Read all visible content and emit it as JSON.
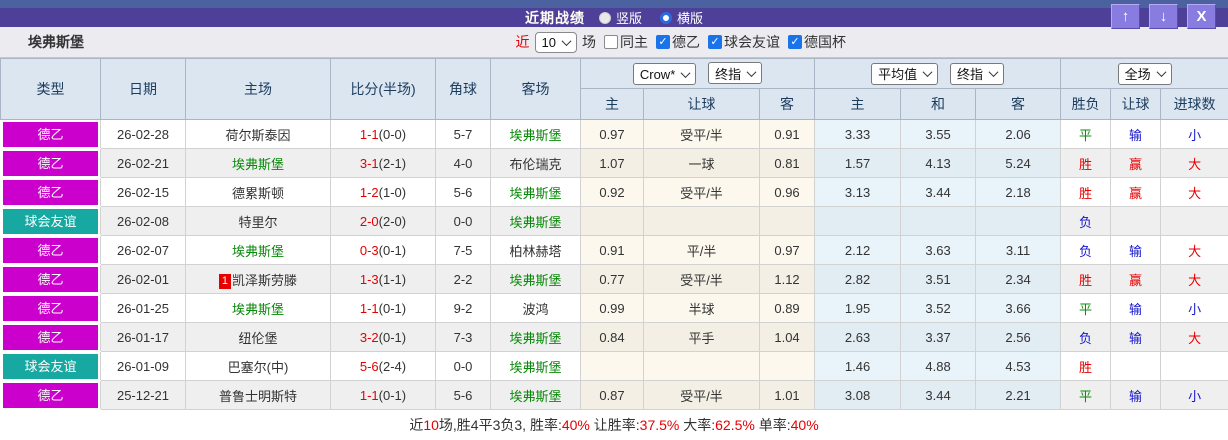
{
  "titlebar": {
    "title": "近期战绩",
    "radios": {
      "vertical": {
        "label": "竖版",
        "checked": false
      },
      "horizontal": {
        "label": "横版",
        "checked": true
      }
    }
  },
  "icons": {
    "up": "↑",
    "down": "↓",
    "close": "X",
    "check": "✓"
  },
  "filter": {
    "team": "埃弗斯堡",
    "recent_label": "近",
    "recent_value": "10",
    "recent_suffix": "场",
    "checkboxes": [
      {
        "label": "同主",
        "checked": false
      },
      {
        "label": "德乙",
        "checked": true
      },
      {
        "label": "球会友谊",
        "checked": true
      },
      {
        "label": "德国杯",
        "checked": true
      }
    ]
  },
  "table": {
    "headers": {
      "type": "类型",
      "date": "日期",
      "home": "主场",
      "score": "比分(半场)",
      "corner": "角球",
      "away": "客场",
      "sub": {
        "h": "主",
        "handicap": "让球",
        "a": "客",
        "avg_h": "主",
        "avg_d": "和",
        "avg_a": "客",
        "wdl": "胜负",
        "let": "让球",
        "goals": "进球数"
      },
      "selects": {
        "bookmaker": "Crow*",
        "final_a": "终指",
        "average": "平均值",
        "final_b": "终指",
        "scope": "全场"
      }
    },
    "rows": [
      {
        "type": "德乙",
        "type_class": "magenta",
        "date": "26-02-28",
        "home": "荷尔斯泰因",
        "home_class": "black",
        "home_badge": "",
        "score_ft": "1-1",
        "score_ht": "(0-0)",
        "corner": "5-7",
        "away": "埃弗斯堡",
        "away_class": "green",
        "odd_h": "0.97",
        "odd_line": "受平/半",
        "odd_a": "0.91",
        "avg_h": "3.33",
        "avg_d": "3.55",
        "avg_a": "2.06",
        "res_wdl": "平",
        "res_wdl_class": "green",
        "res_let": "输",
        "res_let_class": "blue",
        "res_goal": "小",
        "res_goal_class": "blue"
      },
      {
        "type": "德乙",
        "type_class": "magenta",
        "date": "26-02-21",
        "home": "埃弗斯堡",
        "home_class": "green",
        "home_badge": "",
        "score_ft": "3-1",
        "score_ht": "(2-1)",
        "corner": "4-0",
        "away": "布伦瑞克",
        "away_class": "black",
        "odd_h": "1.07",
        "odd_line": "一球",
        "odd_a": "0.81",
        "avg_h": "1.57",
        "avg_d": "4.13",
        "avg_a": "5.24",
        "res_wdl": "胜",
        "res_wdl_class": "red",
        "res_let": "赢",
        "res_let_class": "red",
        "res_goal": "大",
        "res_goal_class": "red"
      },
      {
        "type": "德乙",
        "type_class": "magenta",
        "date": "26-02-15",
        "home": "德累斯顿",
        "home_class": "black",
        "home_badge": "",
        "score_ft": "1-2",
        "score_ht": "(1-0)",
        "corner": "5-6",
        "away": "埃弗斯堡",
        "away_class": "green",
        "odd_h": "0.92",
        "odd_line": "受平/半",
        "odd_a": "0.96",
        "avg_h": "3.13",
        "avg_d": "3.44",
        "avg_a": "2.18",
        "res_wdl": "胜",
        "res_wdl_class": "red",
        "res_let": "赢",
        "res_let_class": "red",
        "res_goal": "大",
        "res_goal_class": "red"
      },
      {
        "type": "球会友谊",
        "type_class": "teal",
        "date": "26-02-08",
        "home": "特里尔",
        "home_class": "black",
        "home_badge": "",
        "score_ft": "2-0",
        "score_ht": "(2-0)",
        "corner": "0-0",
        "away": "埃弗斯堡",
        "away_class": "green",
        "odd_h": "",
        "odd_line": "",
        "odd_a": "",
        "avg_h": "",
        "avg_d": "",
        "avg_a": "",
        "res_wdl": "负",
        "res_wdl_class": "blue",
        "res_let": "",
        "res_let_class": "black",
        "res_goal": "",
        "res_goal_class": "black"
      },
      {
        "type": "德乙",
        "type_class": "magenta",
        "date": "26-02-07",
        "home": "埃弗斯堡",
        "home_class": "green",
        "home_badge": "",
        "score_ft": "0-3",
        "score_ht": "(0-1)",
        "corner": "7-5",
        "away": "柏林赫塔",
        "away_class": "black",
        "odd_h": "0.91",
        "odd_line": "平/半",
        "odd_a": "0.97",
        "avg_h": "2.12",
        "avg_d": "3.63",
        "avg_a": "3.11",
        "res_wdl": "负",
        "res_wdl_class": "blue",
        "res_let": "输",
        "res_let_class": "blue",
        "res_goal": "大",
        "res_goal_class": "red"
      },
      {
        "type": "德乙",
        "type_class": "magenta",
        "date": "26-02-01",
        "home": "凯泽斯劳滕",
        "home_class": "black",
        "home_badge": "1",
        "score_ft": "1-3",
        "score_ht": "(1-1)",
        "corner": "2-2",
        "away": "埃弗斯堡",
        "away_class": "green",
        "odd_h": "0.77",
        "odd_line": "受平/半",
        "odd_a": "1.12",
        "avg_h": "2.82",
        "avg_d": "3.51",
        "avg_a": "2.34",
        "res_wdl": "胜",
        "res_wdl_class": "red",
        "res_let": "赢",
        "res_let_class": "red",
        "res_goal": "大",
        "res_goal_class": "red"
      },
      {
        "type": "德乙",
        "type_class": "magenta",
        "date": "26-01-25",
        "home": "埃弗斯堡",
        "home_class": "green",
        "home_badge": "",
        "score_ft": "1-1",
        "score_ht": "(0-1)",
        "corner": "9-2",
        "away": "波鸿",
        "away_class": "black",
        "odd_h": "0.99",
        "odd_line": "半球",
        "odd_a": "0.89",
        "avg_h": "1.95",
        "avg_d": "3.52",
        "avg_a": "3.66",
        "res_wdl": "平",
        "res_wdl_class": "green",
        "res_let": "输",
        "res_let_class": "blue",
        "res_goal": "小",
        "res_goal_class": "blue"
      },
      {
        "type": "德乙",
        "type_class": "magenta",
        "date": "26-01-17",
        "home": "纽伦堡",
        "home_class": "black",
        "home_badge": "",
        "score_ft": "3-2",
        "score_ht": "(0-1)",
        "corner": "7-3",
        "away": "埃弗斯堡",
        "away_class": "green",
        "odd_h": "0.84",
        "odd_line": "平手",
        "odd_a": "1.04",
        "avg_h": "2.63",
        "avg_d": "3.37",
        "avg_a": "2.56",
        "res_wdl": "负",
        "res_wdl_class": "blue",
        "res_let": "输",
        "res_let_class": "blue",
        "res_goal": "大",
        "res_goal_class": "red"
      },
      {
        "type": "球会友谊",
        "type_class": "teal",
        "date": "26-01-09",
        "home": "巴塞尔(中)",
        "home_class": "black",
        "home_badge": "",
        "score_ft": "5-6",
        "score_ht": "(2-4)",
        "corner": "0-0",
        "away": "埃弗斯堡",
        "away_class": "green",
        "odd_h": "",
        "odd_line": "",
        "odd_a": "",
        "avg_h": "1.46",
        "avg_d": "4.88",
        "avg_a": "4.53",
        "res_wdl": "胜",
        "res_wdl_class": "red",
        "res_let": "",
        "res_let_class": "black",
        "res_goal": "",
        "res_goal_class": "black"
      },
      {
        "type": "德乙",
        "type_class": "magenta",
        "date": "25-12-21",
        "home": "普鲁士明斯特",
        "home_class": "black",
        "home_badge": "",
        "score_ft": "1-1",
        "score_ht": "(0-1)",
        "corner": "5-6",
        "away": "埃弗斯堡",
        "away_class": "green",
        "odd_h": "0.87",
        "odd_line": "受平/半",
        "odd_a": "1.01",
        "avg_h": "3.08",
        "avg_d": "3.44",
        "avg_a": "2.21",
        "res_wdl": "平",
        "res_wdl_class": "green",
        "res_let": "输",
        "res_let_class": "blue",
        "res_goal": "小",
        "res_goal_class": "blue"
      }
    ]
  },
  "footer": {
    "parts": [
      {
        "text": "近",
        "color": "black"
      },
      {
        "text": "10",
        "color": "red"
      },
      {
        "text": "场,胜4平3负3, 胜率:",
        "color": "black"
      },
      {
        "text": "40%",
        "color": "red"
      },
      {
        "text": " 让胜率:",
        "color": "black"
      },
      {
        "text": "37.5%",
        "color": "red"
      },
      {
        "text": " 大率:",
        "color": "black"
      },
      {
        "text": "62.5%",
        "color": "red"
      },
      {
        "text": " 单率:",
        "color": "black"
      },
      {
        "text": "40%",
        "color": "red"
      }
    ]
  },
  "colors": {
    "title_bar": "#4e3f99",
    "top_strip": "#4b61a0",
    "league_magenta": "#cc00cc",
    "friendly_teal": "#17a8a1",
    "win_red": "#e60000",
    "lose_blue": "#1515cc",
    "draw_green": "#0a8a0a",
    "header_bg": "#dce6f1",
    "odds_bg": "#fcf8ee",
    "avg_bg": "#e8f3fa"
  }
}
